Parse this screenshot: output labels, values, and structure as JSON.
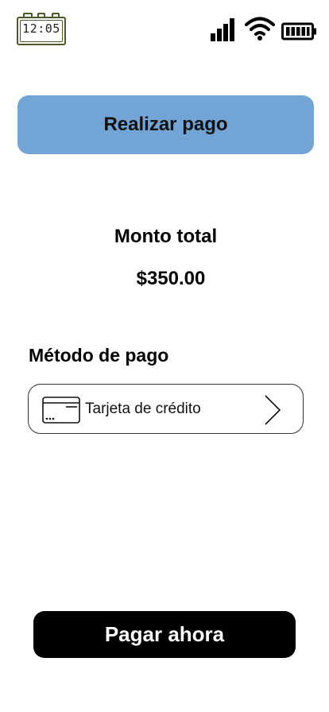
{
  "status_bar": {
    "time": "12:05",
    "signal_icon": "signal-bars-icon",
    "wifi_icon": "wifi-icon",
    "battery_icon": "battery-full-icon"
  },
  "header": {
    "title": "Realizar pago",
    "color": "#72a4d5"
  },
  "summary": {
    "total_label": "Monto total",
    "total_amount": "$350.00"
  },
  "payment_method": {
    "section_label": "Método de pago",
    "selected": "Tarjeta de crédito",
    "icon": "credit-card-icon"
  },
  "actions": {
    "pay_label": "Pagar ahora"
  }
}
